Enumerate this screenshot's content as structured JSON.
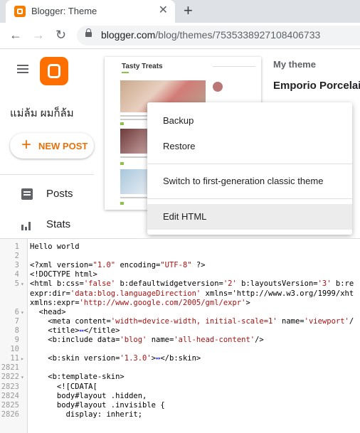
{
  "browser": {
    "tab_title": "Blogger: Theme",
    "tab_close": "✕",
    "new_tab": "+",
    "url_host": "blogger.com",
    "url_path": "/blog/themes/7535338927108406733",
    "back": "←",
    "forward": "→",
    "reload": "↻"
  },
  "app": {
    "blog_name": "แม่ล้ม ผมก็ล้ม",
    "new_post_plus": "+",
    "new_post_label": "NEW POST",
    "nav": [
      {
        "label": "Posts",
        "icon": "posts-icon"
      },
      {
        "label": "Stats",
        "icon": "stats-icon"
      }
    ]
  },
  "theme": {
    "preview_title": "Tasty Treats",
    "my_theme_label": "My theme",
    "theme_name": "Emporio Porcelain"
  },
  "menu": {
    "items": [
      "Backup",
      "Restore",
      "Switch to first-generation classic theme",
      "Edit HTML"
    ],
    "active_index": 3
  },
  "editor": {
    "lines": [
      {
        "n": "1",
        "fold": "",
        "html": "Hello world"
      },
      {
        "n": "2",
        "fold": "",
        "html": ""
      },
      {
        "n": "3",
        "fold": "",
        "html": "<?xml version=\"1.0\" encoding=\"UTF-8\" ?>"
      },
      {
        "n": "4",
        "fold": "",
        "html": "<!DOCTYPE html>"
      },
      {
        "n": "5",
        "fold": "▾",
        "html": "<html b:css='false' b:defaultwidgetversion='2' b:layoutsVersion='3' b:re"
      },
      {
        "n": "",
        "fold": "",
        "html": "expr:dir='data:blog.languageDirection' xmlns='http://www.w3.org/1999/xht"
      },
      {
        "n": "",
        "fold": "",
        "html": "xmlns:expr='http://www.google.com/2005/gml/expr'>"
      },
      {
        "n": "6",
        "fold": "▾",
        "html": "  <head>"
      },
      {
        "n": "7",
        "fold": "",
        "html": "    <meta content='width=device-width, initial-scale=1' name='viewport'/"
      },
      {
        "n": "8",
        "fold": "",
        "html": "    <title>↔</title>"
      },
      {
        "n": "9",
        "fold": "",
        "html": "    <b:include data='blog' name='all-head-content'/>"
      },
      {
        "n": "10",
        "fold": "",
        "html": ""
      },
      {
        "n": "11",
        "fold": "▸",
        "html": "    <b:skin version='1.3.0'>↔</b:skin>"
      },
      {
        "n": "2821",
        "fold": "",
        "html": ""
      },
      {
        "n": "2822",
        "fold": "▾",
        "html": "    <b:template-skin>"
      },
      {
        "n": "2823",
        "fold": "",
        "html": "      <![CDATA["
      },
      {
        "n": "2824",
        "fold": "",
        "html": "      body#layout .hidden,"
      },
      {
        "n": "2825",
        "fold": "",
        "html": "      body#layout .invisible {"
      },
      {
        "n": "2826",
        "fold": "",
        "html": "        display: inherit;"
      }
    ]
  }
}
